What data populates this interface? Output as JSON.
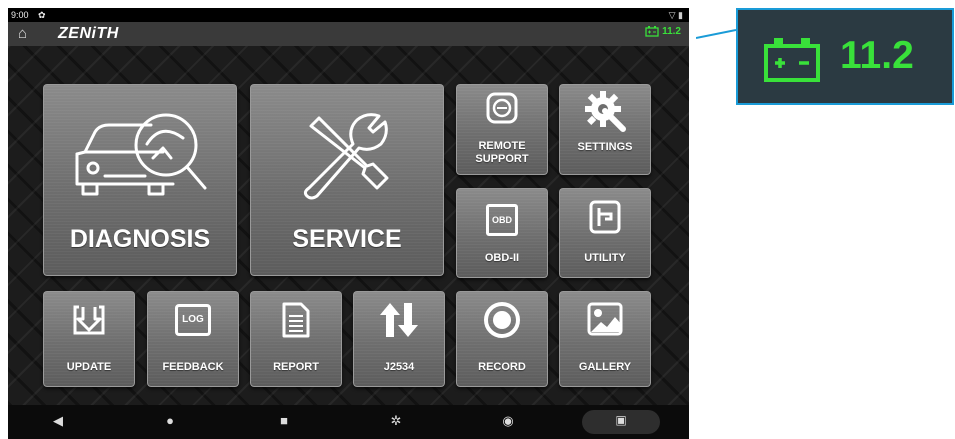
{
  "status_bar": {
    "time": "9:00"
  },
  "app_bar": {
    "logo": "ZENiTH",
    "battery_voltage": "11.2"
  },
  "tiles": {
    "diagnosis": "DIAGNOSIS",
    "service": "SERVICE",
    "remote_support": "REMOTE SUPPORT",
    "settings": "SETTINGS",
    "obd2": "OBD-II",
    "obd_badge": "OBD",
    "utility": "UTILITY",
    "update": "UPDATE",
    "feedback": "FEEDBACK",
    "log_badge": "LOG",
    "report": "REPORT",
    "j2534": "J2534",
    "record": "RECORD",
    "gallery": "GALLERY"
  },
  "zoom_callout": {
    "voltage": "11.2"
  },
  "colors": {
    "battery_green": "#39e13a",
    "callout_blue": "#1a9bd7"
  }
}
